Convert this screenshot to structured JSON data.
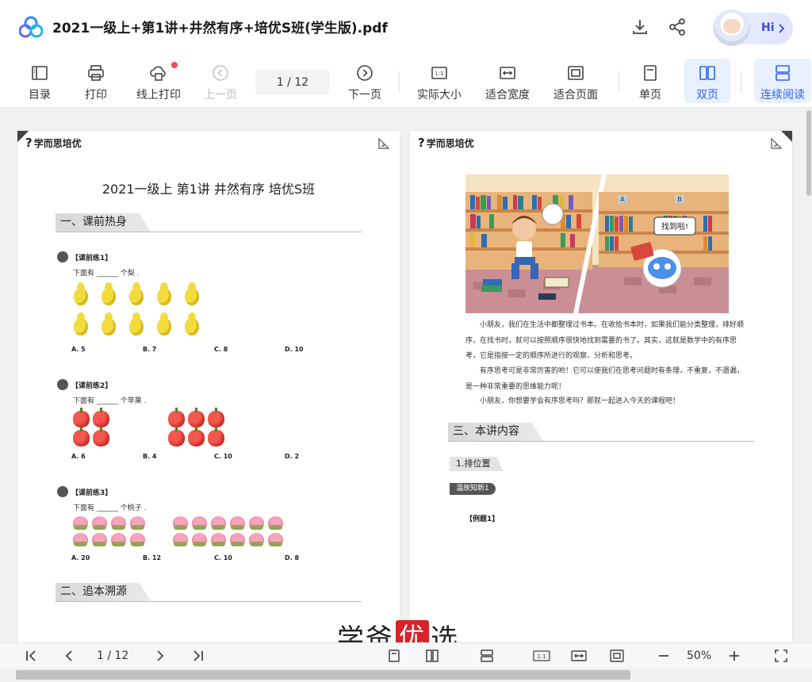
{
  "header": {
    "title": "2021一级上+第1讲+井然有序+培优S班(学生版).pdf",
    "hi_label": "Hi"
  },
  "toolbar": {
    "toc": "目录",
    "print": "打印",
    "online_print": "线上打印",
    "prev_page": "上一页",
    "page_indicator": "1  / 12",
    "next_page": "下一页",
    "actual_size": "实际大小",
    "fit_width": "适合宽度",
    "fit_page": "适合页面",
    "single_page": "单页",
    "double_page": "双页",
    "continuous": "连续阅读",
    "accent_color": "#2f62f0"
  },
  "left_page": {
    "brand": "学而思培优",
    "heading": "2021一级上 第1讲 井然有序 培优S班",
    "section1": "一、课前热身",
    "ex1": {
      "label": "【课前练1】",
      "question": "下面有 ______ 个梨 .",
      "options": [
        "A. 5",
        "B. 7",
        "C. 8",
        "D. 10"
      ]
    },
    "ex2": {
      "label": "【课前练2】",
      "question": "下面有 ______ 个苹果 .",
      "options": [
        "A. 6",
        "B. 4",
        "C. 10",
        "D. 2"
      ]
    },
    "ex3": {
      "label": "【课前练3】",
      "question": "下面有 ______ 个桃子 .",
      "options": [
        "A. 20",
        "B. 12",
        "C. 10",
        "D. 8"
      ]
    },
    "section2": "二、追本溯源"
  },
  "right_page": {
    "brand": "学而思培优",
    "speech_bubble": "找到啦!",
    "shelf_labels": [
      "A",
      "B"
    ],
    "para1": "小朋友，我们在生活中都整理过书本。在收拾书本时，如果我们能分类整理，排好顺序，在找书时，就可以按照顺序很快地找到需要的书了。其实，这就是数学中的有序思考，它是指按一定的顺序所进行的观察、分析和思考。",
    "para2": "有序思考可是非常厉害的哟！它可以使我们在思考问题时有条理，不重复，不遗漏，是一种非常重要的思维能力呢！",
    "para3": "小朋友，你想要学会有序思考吗？那就一起进入今天的课程吧！",
    "section3": "三、本讲内容",
    "subsection": "1.排位置",
    "tag": "温故知新1",
    "example": "【例题1】"
  },
  "watermark": {
    "text_before": "学爸",
    "text_red": "优",
    "text_after": "选"
  },
  "bottombar": {
    "page_indicator": "1  / 12",
    "zoom": "50%"
  }
}
